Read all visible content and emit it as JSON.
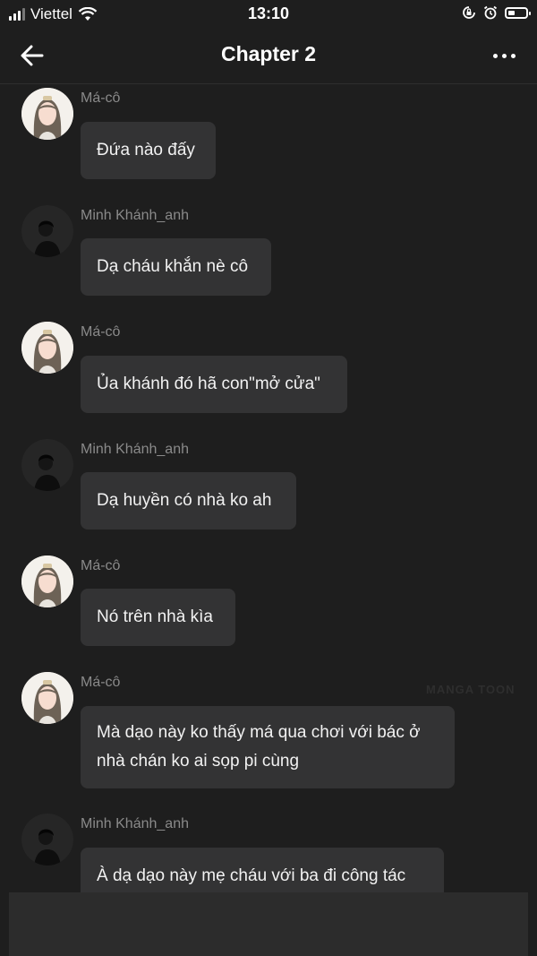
{
  "status_bar": {
    "carrier": "Viettel",
    "time": "13:10",
    "battery_level": 0.4
  },
  "app_bar": {
    "title": "Chapter 2",
    "back_icon": "arrow-left-icon",
    "more_icon": "more-horizontal-icon"
  },
  "messages": [
    {
      "sender": "Má-cô",
      "avatar": "female-avatar",
      "text": "Đứa nào đấy"
    },
    {
      "sender": "Minh Khánh_anh",
      "avatar": "male-avatar",
      "text": "Dạ cháu khắn nè cô"
    },
    {
      "sender": "Má-cô",
      "avatar": "female-avatar",
      "text": "Ủa khánh đó hã con\"mở cửa\""
    },
    {
      "sender": "Minh Khánh_anh",
      "avatar": "male-avatar",
      "text": "Dạ huyền có nhà ko ah"
    },
    {
      "sender": "Má-cô",
      "avatar": "female-avatar",
      "text": "Nó trên nhà kìa"
    },
    {
      "sender": "Má-cô",
      "avatar": "female-avatar",
      "text": "Mà dạo này ko thấy má qua chơi với bác ở\nnhà chán ko ai sọp pi cùng"
    },
    {
      "sender": "Minh Khánh_anh",
      "avatar": "male-avatar",
      "text": "À dạ dạo này mẹ cháu với ba đi công tác"
    }
  ],
  "watermark": "MANGA TOON"
}
